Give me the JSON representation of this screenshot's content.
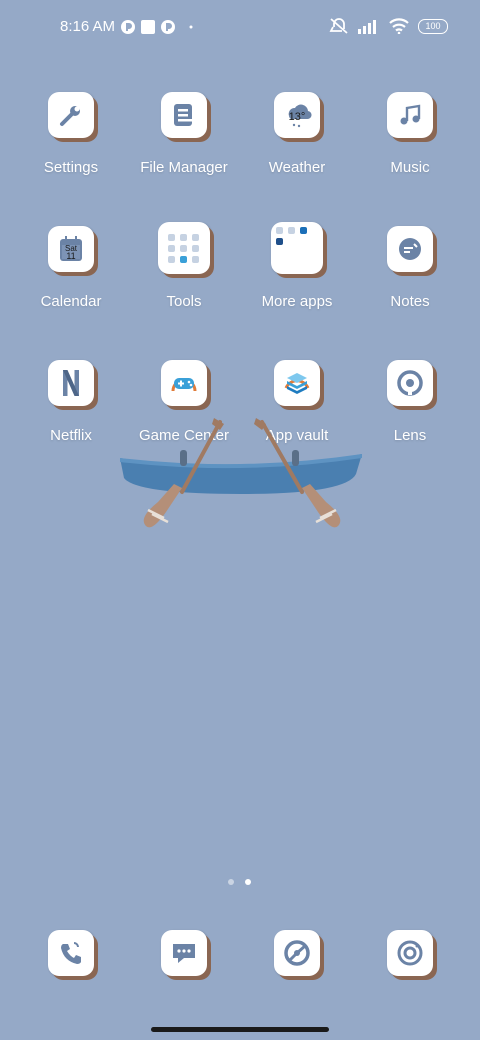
{
  "status_bar": {
    "time": "8:16 AM",
    "battery": "100",
    "icons": [
      "pocket-icon",
      "square-notification-icon",
      "pocket-icon",
      "dot-icon",
      "mute-icon",
      "signal-icon",
      "wifi-icon",
      "battery-icon"
    ]
  },
  "apps": [
    {
      "label": "Settings",
      "icon": "settings-icon"
    },
    {
      "label": "File Manager",
      "icon": "file-manager-icon"
    },
    {
      "label": "Weather",
      "icon": "weather-icon",
      "temp": "13°"
    },
    {
      "label": "Music",
      "icon": "music-icon"
    },
    {
      "label": "Calendar",
      "icon": "calendar-icon",
      "day": "Sat",
      "date": "11"
    },
    {
      "label": "Tools",
      "icon": "folder-icon"
    },
    {
      "label": "More apps",
      "icon": "folder-icon"
    },
    {
      "label": "Notes",
      "icon": "notes-icon"
    },
    {
      "label": "Netflix",
      "icon": "netflix-icon"
    },
    {
      "label": "Game Center",
      "icon": "gamepad-icon"
    },
    {
      "label": "App vault",
      "icon": "app-vault-icon"
    },
    {
      "label": "Lens",
      "icon": "lens-icon"
    }
  ],
  "dock": [
    {
      "icon": "phone-icon"
    },
    {
      "icon": "messages-icon"
    },
    {
      "icon": "browser-icon"
    },
    {
      "icon": "camera-icon"
    }
  ],
  "pages": {
    "count": 2,
    "active": 2
  },
  "colors": {
    "wallpaper": "#95a9c7",
    "icon_accent": "#6b83a6",
    "shadow": "#8a6652"
  }
}
